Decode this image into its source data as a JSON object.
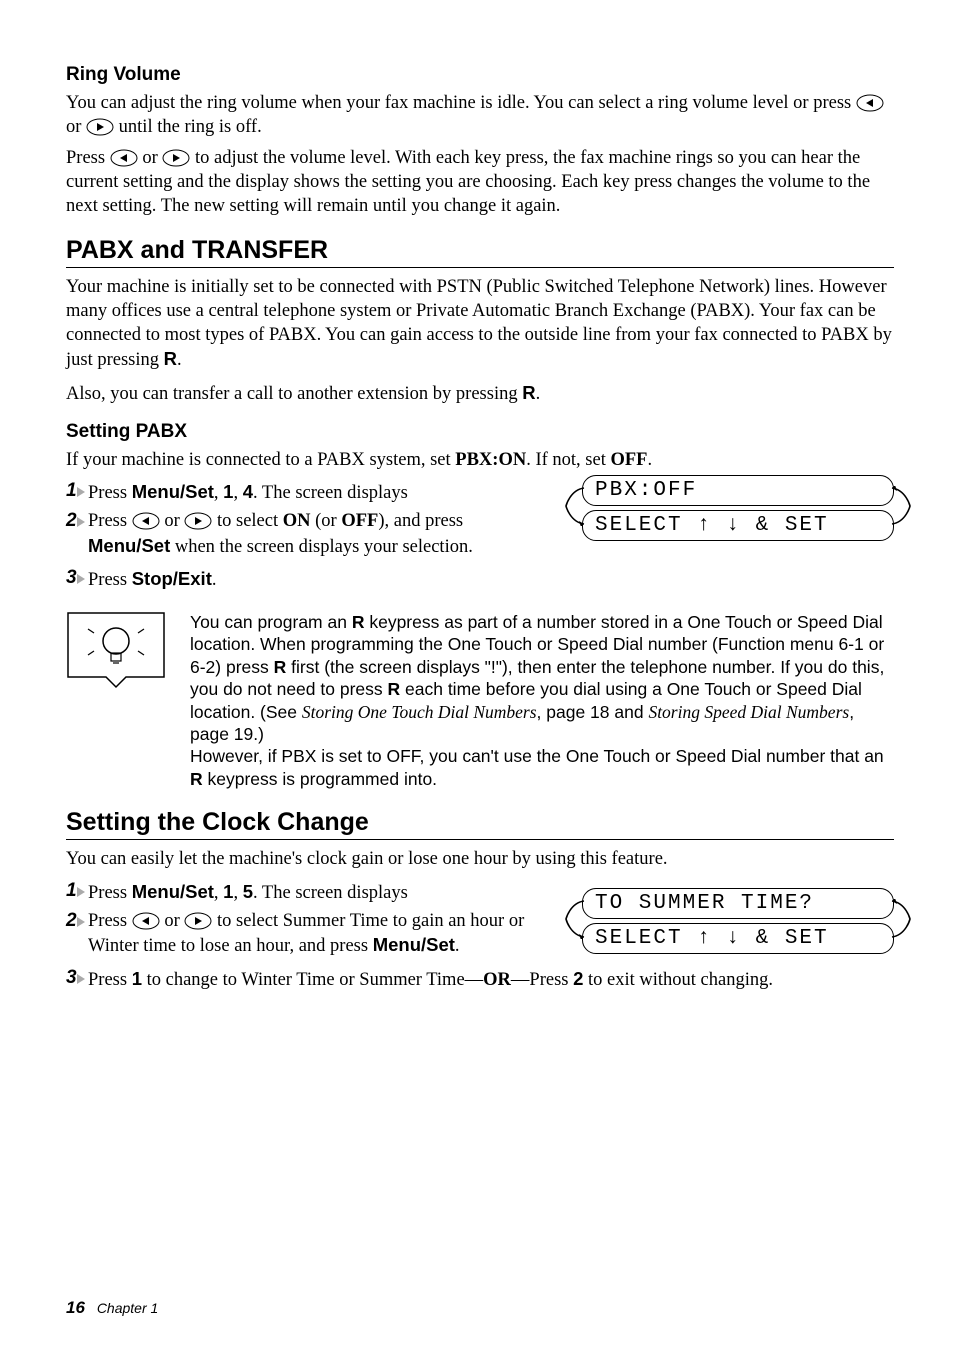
{
  "ring": {
    "heading": "Ring Volume",
    "p1a": "You can adjust the ring volume when your fax machine is idle. You can select a ring volume level or press ",
    "p1b": " or ",
    "p1c": " until the ring is off.",
    "p2a": "Press ",
    "p2b": " or ",
    "p2c": " to adjust the volume level. With each key press, the fax machine rings so you can hear the current setting and the display shows the setting you are choosing. Each key press changes the volume to the next setting. The new setting will remain until you change it again."
  },
  "pabx": {
    "heading": "PABX and TRANSFER",
    "p1a": "Your machine is initially set to be connected with PSTN (Public Switched Telephone Network) lines. However many offices use a central telephone system or Private Automatic Branch Exchange (PABX). Your fax can be connected to most types of PABX. You can gain access to the outside line from your fax connected to PABX by just pressing ",
    "p1_key": "R",
    "p1b": ".",
    "p2a": "Also, you can transfer a call to another extension by pressing ",
    "p2_key": "R",
    "p2b": "."
  },
  "setting_pabx": {
    "heading": "Setting PABX",
    "intro_a": "If your machine is connected to a PABX system, set ",
    "intro_b": "PBX:ON",
    "intro_c": ". If not, set ",
    "intro_d": "OFF",
    "intro_e": ".",
    "step1_a": "Press ",
    "step1_b": "Menu/Set",
    "step1_c": ", ",
    "step1_d": "1",
    "step1_e": ", ",
    "step1_f": "4",
    "step1_g": ". The screen displays",
    "step2_a": "Press ",
    "step2_b": " or ",
    "step2_c": " to select ",
    "step2_d": "ON",
    "step2_e": " (or ",
    "step2_f": "OFF",
    "step2_g": "), and press ",
    "step2_h": "Menu/Set",
    "step2_i": " when the screen displays your selection.",
    "step3_a": "Press ",
    "step3_b": "Stop/Exit",
    "step3_c": ".",
    "lcd1": "PBX:OFF",
    "lcd2": "SELECT ↑ ↓ & SET"
  },
  "tip": {
    "a": "You can program an ",
    "b": "R",
    "c": " keypress as part of a number stored in a One Touch or Speed Dial location. When programming the One Touch or Speed Dial number (Function menu 6-1 or 6-2) press ",
    "d": "R",
    "e": " first (the screen displays \"!\"), then enter the telephone number. If you do this, you do not need to press ",
    "f": "R",
    "g": " each time before you dial using a One Touch or Speed Dial location. (See ",
    "h": "Storing One Touch Dial Numbers",
    "i": ", page 18 and ",
    "j": "Storing Speed Dial Numbers",
    "k": ", page 19.)",
    "l": "However, if PBX is set to OFF, you can't use the One Touch or Speed Dial number that an ",
    "m": "R",
    "n": " keypress is programmed into."
  },
  "clock": {
    "heading": "Setting the Clock Change",
    "intro": "You can easily let the machine's clock gain or lose one hour by using this feature.",
    "step1_a": "Press ",
    "step1_b": "Menu/Set",
    "step1_c": ", ",
    "step1_d": "1",
    "step1_e": ", ",
    "step1_f": "5",
    "step1_g": ". The screen displays",
    "step2_a": "Press ",
    "step2_b": " or ",
    "step2_c": " to select Summer Time to gain an hour or Winter time to lose an hour, and press ",
    "step2_d": "Menu/Set",
    "step2_e": ".",
    "step3_a": "Press ",
    "step3_b": "1",
    "step3_c": " to change to Winter Time or Summer Time—",
    "step3_d": "OR",
    "step3_e": "—Press ",
    "step3_f": "2",
    "step3_g": " to exit without changing.",
    "lcd1": "TO SUMMER TIME?",
    "lcd2": "SELECT ↑ ↓ & SET"
  },
  "footer": {
    "page": "16",
    "chapter": "Chapter 1"
  }
}
